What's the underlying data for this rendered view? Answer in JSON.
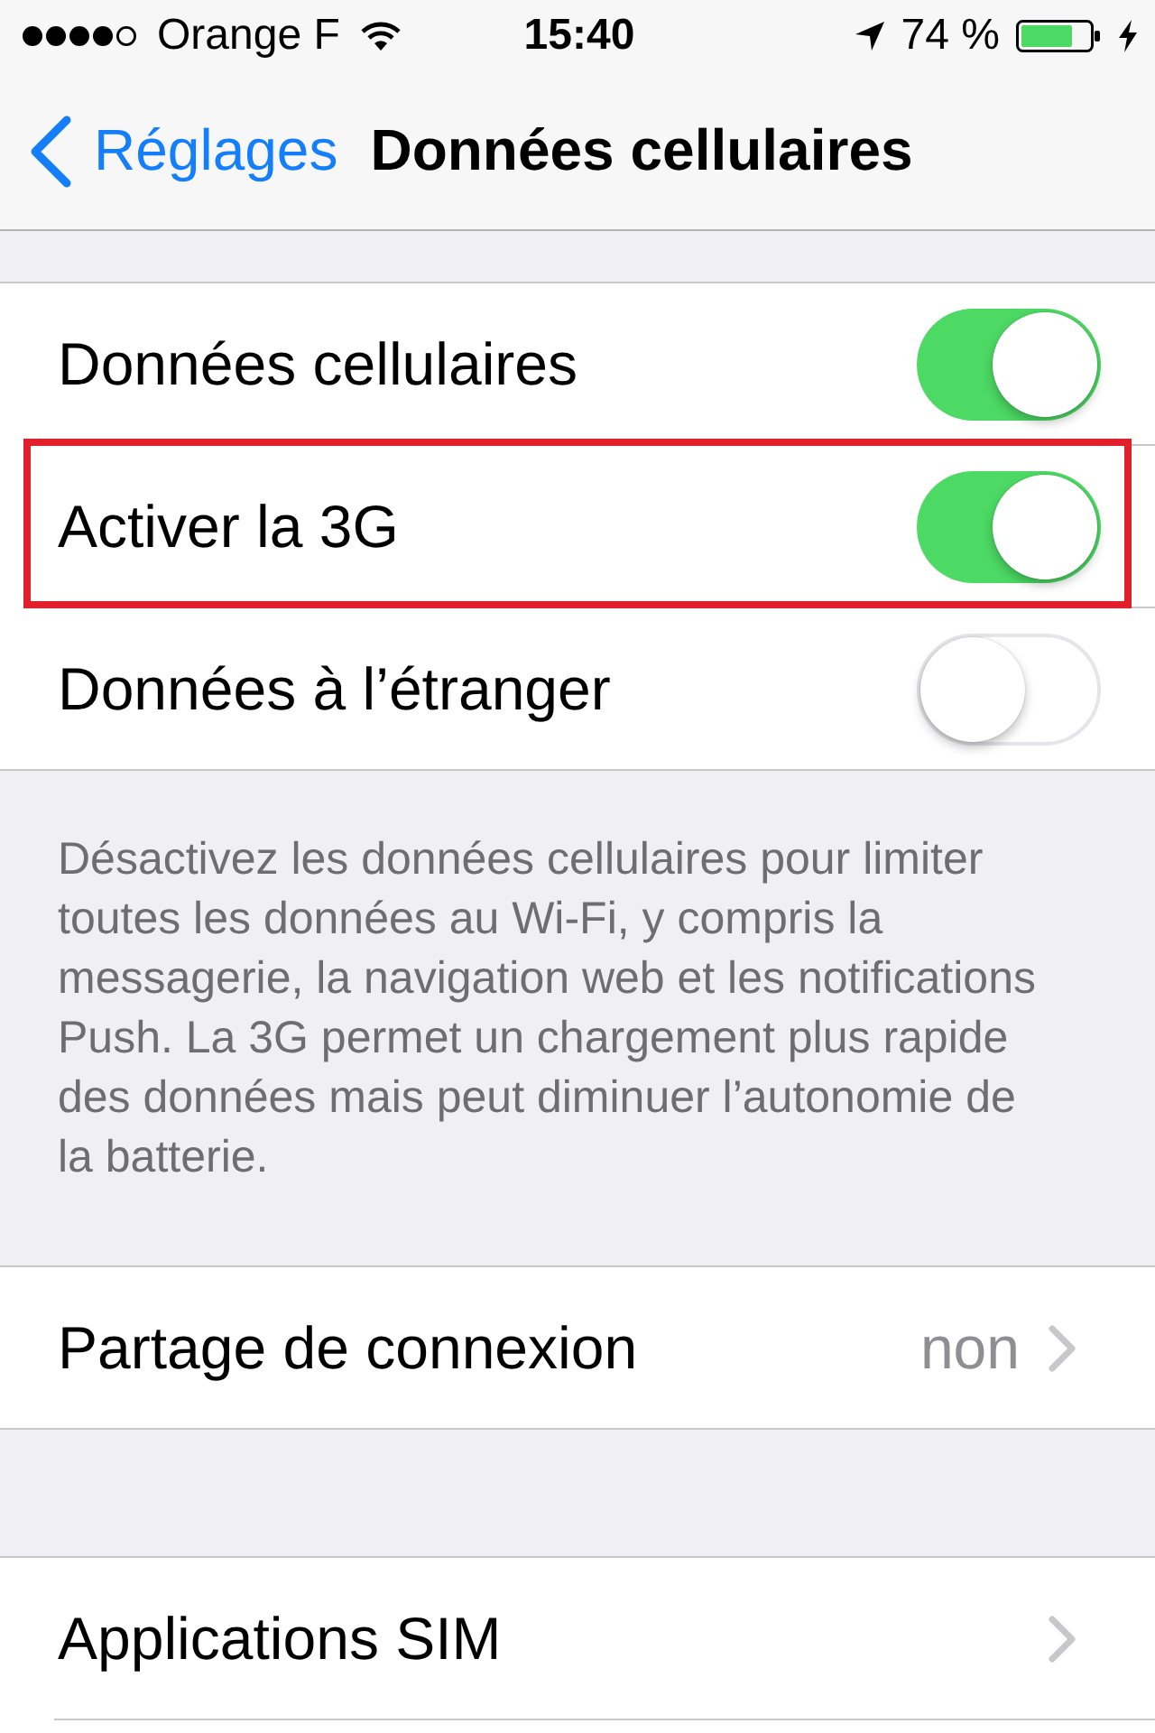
{
  "status_bar": {
    "carrier": "Orange F",
    "time": "15:40",
    "battery": "74 %"
  },
  "nav_bar": {
    "back": "Réglages",
    "title": "Données cellulaires"
  },
  "groups": [
    {
      "rows": [
        {
          "kind": "toggle",
          "label": "Données cellulaires",
          "on": true,
          "highlighted": false
        },
        {
          "kind": "toggle",
          "label": "Activer la 3G",
          "on": true,
          "highlighted": true
        },
        {
          "kind": "toggle",
          "label": "Données à l’étranger",
          "on": false,
          "highlighted": false
        }
      ],
      "footer": "Désactivez les données cellulaires pour limiter toutes les données au Wi-Fi, y compris la messagerie, la navigation web et les notifications Push. La 3G permet un chargement plus rapide des données mais peut diminuer l’autonomie de la batterie."
    },
    {
      "rows": [
        {
          "kind": "link",
          "label": "Partage de connexion",
          "value": "non",
          "highlighted": false
        }
      ]
    },
    {
      "rows": [
        {
          "kind": "link",
          "label": "Applications SIM",
          "highlighted": false
        }
      ]
    }
  ]
}
